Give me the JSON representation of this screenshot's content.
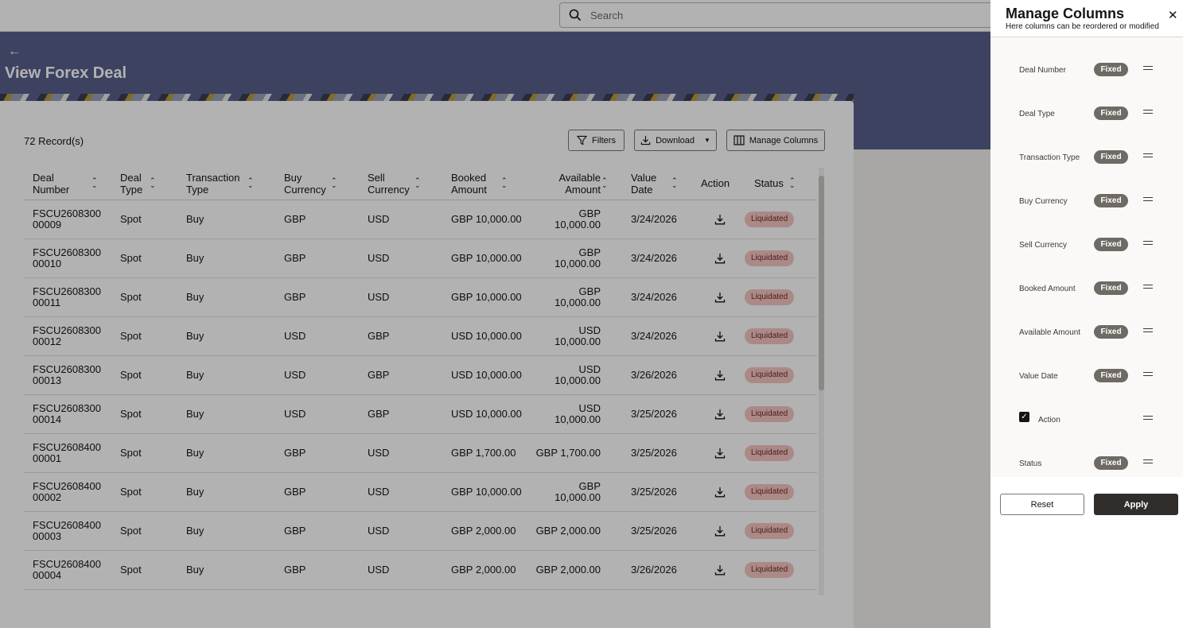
{
  "search": {
    "placeholder": "Search"
  },
  "page": {
    "title": "View Forex Deal",
    "back_label": "←"
  },
  "toolbar": {
    "records": "72 Record(s)",
    "filters_label": "Filters",
    "download_label": "Download",
    "manage_columns_label": "Manage Columns"
  },
  "table": {
    "headers": {
      "deal_number": [
        "Deal",
        "Number"
      ],
      "deal_type": [
        "Deal",
        "Type"
      ],
      "transaction_type": [
        "Transaction",
        "Type"
      ],
      "buy_currency": [
        "Buy",
        "Currency"
      ],
      "sell_currency": [
        "Sell",
        "Currency"
      ],
      "booked_amount": [
        "Booked",
        "Amount"
      ],
      "available_amount": [
        "Available",
        "Amount"
      ],
      "value_date": [
        "Value",
        "Date"
      ],
      "action": "Action",
      "status": "Status"
    },
    "rows": [
      {
        "deal": [
          "FSCU2608300",
          "00009"
        ],
        "type": "Spot",
        "txn": "Buy",
        "buy": "GBP",
        "sell": "USD",
        "booked": "GBP 10,000.00",
        "available": "GBP 10,000.00",
        "date": "3/24/2026",
        "status": "Liquidated"
      },
      {
        "deal": [
          "FSCU2608300",
          "00010"
        ],
        "type": "Spot",
        "txn": "Buy",
        "buy": "GBP",
        "sell": "USD",
        "booked": "GBP 10,000.00",
        "available": "GBP 10,000.00",
        "date": "3/24/2026",
        "status": "Liquidated"
      },
      {
        "deal": [
          "FSCU2608300",
          "00011"
        ],
        "type": "Spot",
        "txn": "Buy",
        "buy": "GBP",
        "sell": "USD",
        "booked": "GBP 10,000.00",
        "available": "GBP 10,000.00",
        "date": "3/24/2026",
        "status": "Liquidated"
      },
      {
        "deal": [
          "FSCU2608300",
          "00012"
        ],
        "type": "Spot",
        "txn": "Buy",
        "buy": "USD",
        "sell": "GBP",
        "booked": "USD 10,000.00",
        "available": "USD 10,000.00",
        "date": "3/24/2026",
        "status": "Liquidated"
      },
      {
        "deal": [
          "FSCU2608300",
          "00013"
        ],
        "type": "Spot",
        "txn": "Buy",
        "buy": "USD",
        "sell": "GBP",
        "booked": "USD 10,000.00",
        "available": "USD 10,000.00",
        "date": "3/26/2026",
        "status": "Liquidated"
      },
      {
        "deal": [
          "FSCU2608300",
          "00014"
        ],
        "type": "Spot",
        "txn": "Buy",
        "buy": "USD",
        "sell": "GBP",
        "booked": "USD 10,000.00",
        "available": "USD 10,000.00",
        "date": "3/25/2026",
        "status": "Liquidated"
      },
      {
        "deal": [
          "FSCU2608400",
          "00001"
        ],
        "type": "Spot",
        "txn": "Buy",
        "buy": "GBP",
        "sell": "USD",
        "booked": "GBP 1,700.00",
        "available": "GBP 1,700.00",
        "date": "3/25/2026",
        "status": "Liquidated"
      },
      {
        "deal": [
          "FSCU2608400",
          "00002"
        ],
        "type": "Spot",
        "txn": "Buy",
        "buy": "GBP",
        "sell": "USD",
        "booked": "GBP 10,000.00",
        "available": "GBP 10,000.00",
        "date": "3/25/2026",
        "status": "Liquidated"
      },
      {
        "deal": [
          "FSCU2608400",
          "00003"
        ],
        "type": "Spot",
        "txn": "Buy",
        "buy": "GBP",
        "sell": "USD",
        "booked": "GBP 2,000.00",
        "available": "GBP 2,000.00",
        "date": "3/25/2026",
        "status": "Liquidated"
      },
      {
        "deal": [
          "FSCU2608400",
          "00004"
        ],
        "type": "Spot",
        "txn": "Buy",
        "buy": "GBP",
        "sell": "USD",
        "booked": "GBP 2,000.00",
        "available": "GBP 2,000.00",
        "date": "3/26/2026",
        "status": "Liquidated"
      }
    ]
  },
  "drawer": {
    "title": "Manage Columns",
    "subtitle": "Here columns can be reordered or modified",
    "fixed_label": "Fixed",
    "columns": [
      {
        "label": "Deal Number",
        "fixed": true
      },
      {
        "label": "Deal Type",
        "fixed": true
      },
      {
        "label": "Transaction Type",
        "fixed": true
      },
      {
        "label": "Buy Currency",
        "fixed": true
      },
      {
        "label": "Sell Currency",
        "fixed": true
      },
      {
        "label": "Booked Amount",
        "fixed": true
      },
      {
        "label": "Available Amount",
        "fixed": true
      },
      {
        "label": "Value Date",
        "fixed": true
      },
      {
        "label": "Action",
        "fixed": false,
        "checked": true
      },
      {
        "label": "Status",
        "fixed": true
      }
    ],
    "reset_label": "Reset",
    "apply_label": "Apply"
  },
  "colors": {
    "banner": "#5a5f8c",
    "link": "#2a5fa3",
    "badge_bg": "#f4c5c2",
    "fixed_badge": "#6f6a64",
    "apply_bg": "#312d2a"
  }
}
